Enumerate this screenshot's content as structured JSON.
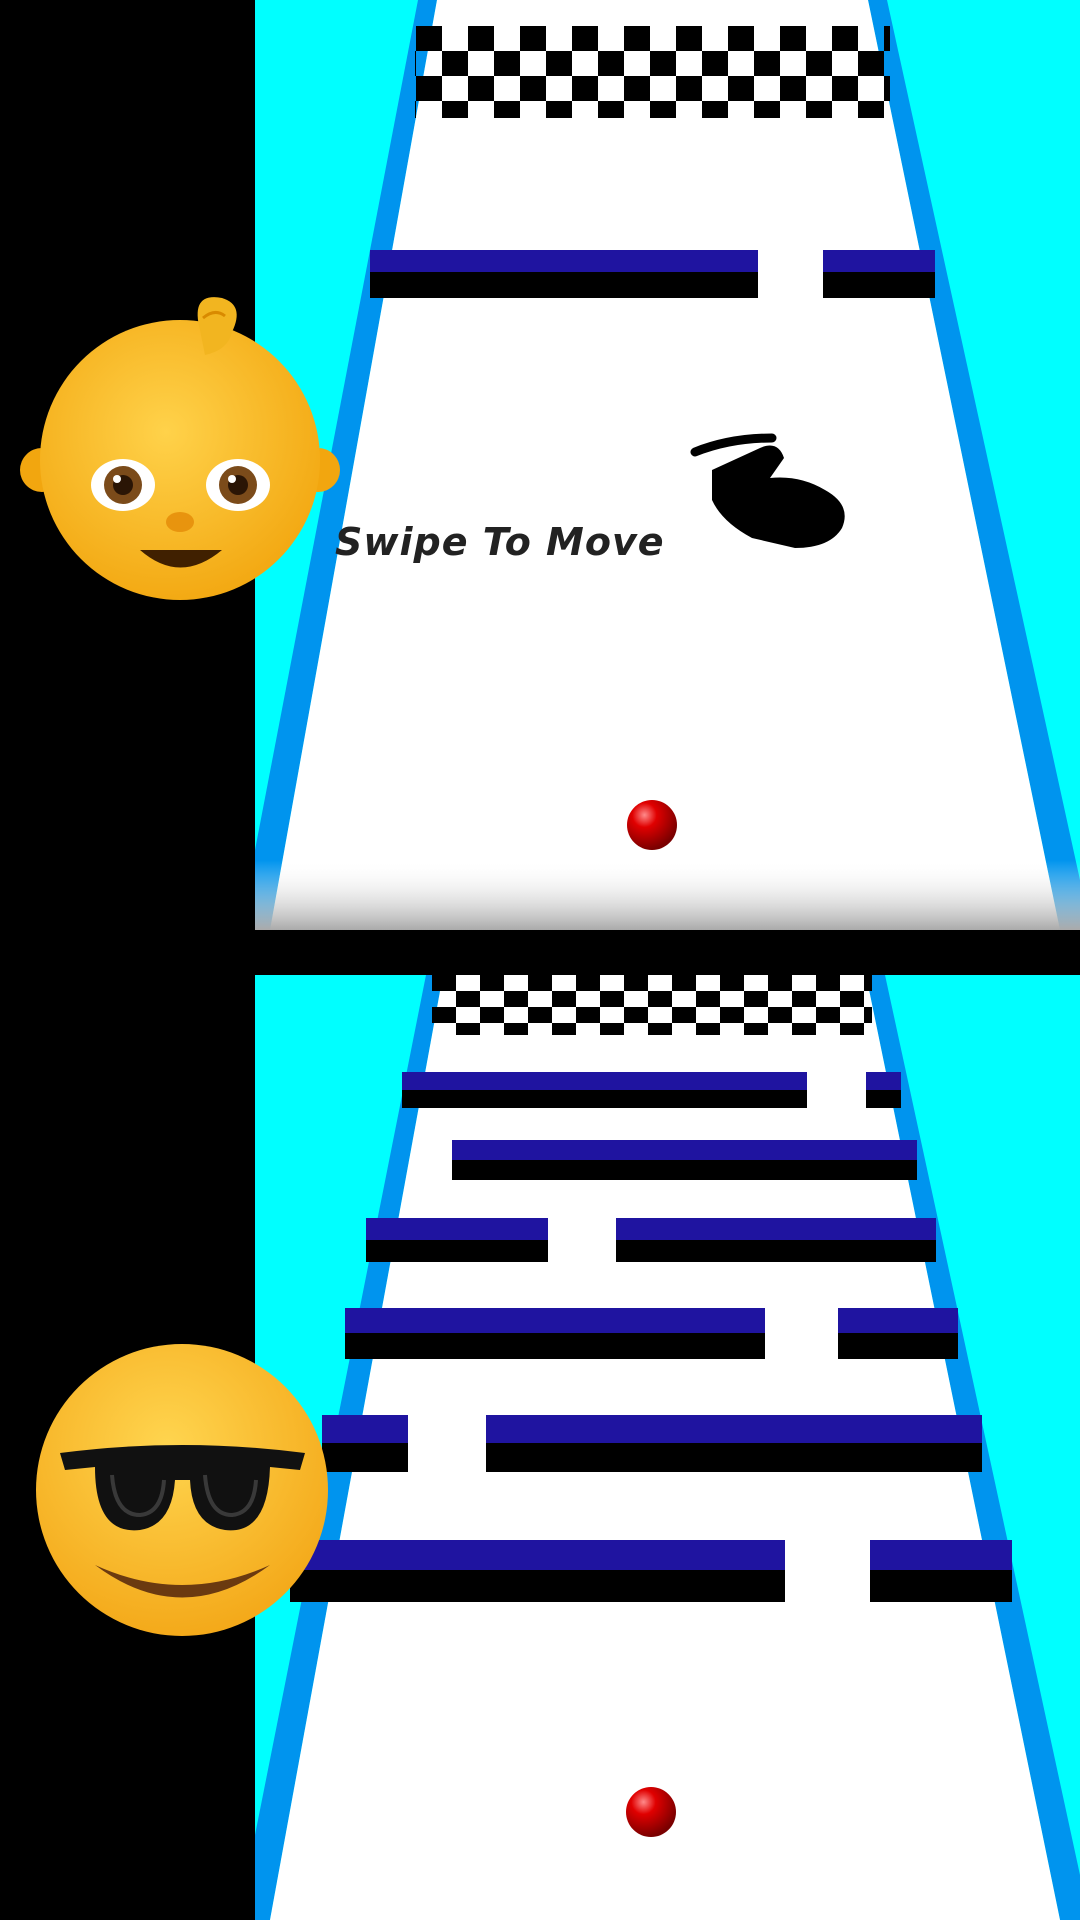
{
  "colors": {
    "background": "#000000",
    "sky": "#00ffff",
    "track": "#ffffff",
    "track_edge": "#0094ee",
    "wall_top": "#1f14a0",
    "wall_side": "#000000",
    "ball": "#cc0000"
  },
  "top_scene": {
    "emoji": "baby-face",
    "hint_text": "Swipe To Move",
    "hint_icon": "swipe-hand-icon",
    "finish_line": "checkered-flag-strip"
  },
  "bottom_scene": {
    "emoji": "sunglasses-face",
    "finish_line": "checkered-flag-strip"
  }
}
